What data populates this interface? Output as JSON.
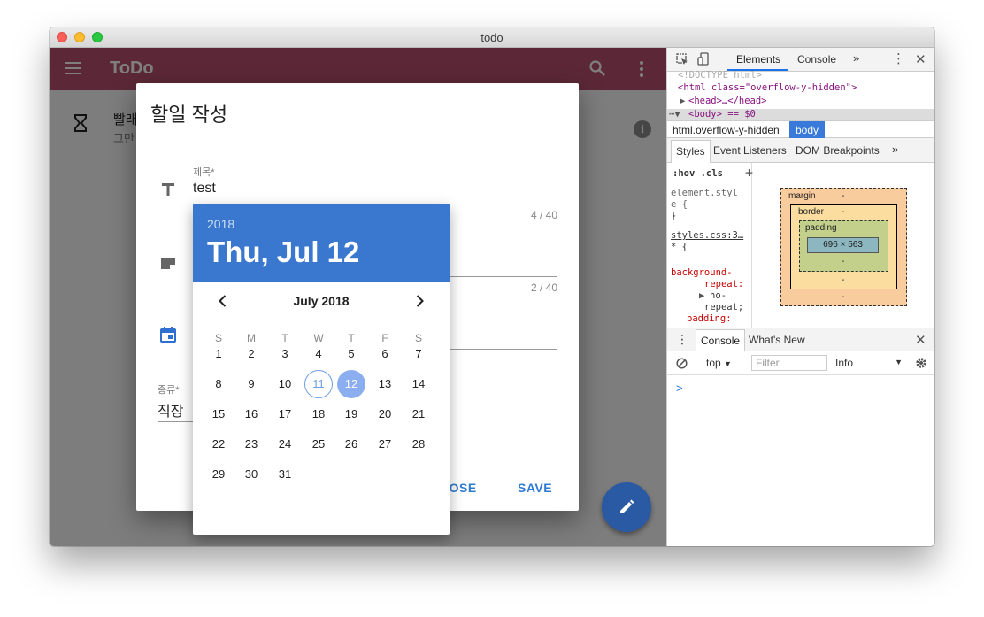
{
  "window": {
    "title": "todo"
  },
  "app": {
    "title": "ToDo",
    "list_item": {
      "title": "빨래",
      "subtitle": "그만",
      "info_icon": "i"
    }
  },
  "dialog": {
    "title": "할일 작성",
    "title_field": {
      "label": "제목*",
      "value": "test",
      "counter": "4 / 40"
    },
    "memo_field": {
      "counter": "2 / 40"
    },
    "type_field": {
      "label": "종류*",
      "value": "직장"
    },
    "buttons": {
      "close": "CLOSE",
      "save": "SAVE"
    }
  },
  "datepicker": {
    "year": "2018",
    "selected_label": "Thu, Jul 12",
    "month_label": "July 2018",
    "weekdays": [
      "S",
      "M",
      "T",
      "W",
      "T",
      "F",
      "S"
    ],
    "weeks": [
      [
        "",
        "1",
        "2",
        "3",
        "4",
        "5",
        "6",
        "7"
      ],
      [
        "8",
        "9",
        "10",
        "11",
        "12",
        "13",
        "14"
      ],
      [
        "15",
        "16",
        "17",
        "18",
        "19",
        "20",
        "21"
      ],
      [
        "22",
        "23",
        "24",
        "25",
        "26",
        "27",
        "28"
      ],
      [
        "29",
        "30",
        "31"
      ]
    ],
    "today": "11",
    "selected": "12"
  },
  "devtools": {
    "tabs": [
      "Elements",
      "Console"
    ],
    "dom": {
      "doctype": "<!DOCTYPE html>",
      "html_open": "<html class=\"overflow-y-hidden\">",
      "head": "<head>…</head>",
      "body": "<body> == $0"
    },
    "breadcrumbs": [
      "html.overflow-y-hidden",
      "body"
    ],
    "sub_tabs": [
      "Styles",
      "Event Listeners",
      "DOM Breakpoints"
    ],
    "styles": {
      "filter": ":hov .cls",
      "element_style_1": "element.styl",
      "element_style_2": "e {",
      "element_style_3": "}",
      "source": "styles.css:3…",
      "rule": "* {",
      "prop_1": "background-",
      "prop_2": "repeat:",
      "prop_3": "no-",
      "prop_4": "repeat;",
      "prop_5": "padding:"
    },
    "box_model": {
      "margin": "margin",
      "border": "border",
      "padding": "padding",
      "content": "696 × 563",
      "dash": "-"
    },
    "drawer_tabs": [
      "Console",
      "What's New"
    ],
    "console": {
      "context": "top",
      "filter_placeholder": "Filter",
      "level": "Info",
      "prompt": ">"
    }
  }
}
